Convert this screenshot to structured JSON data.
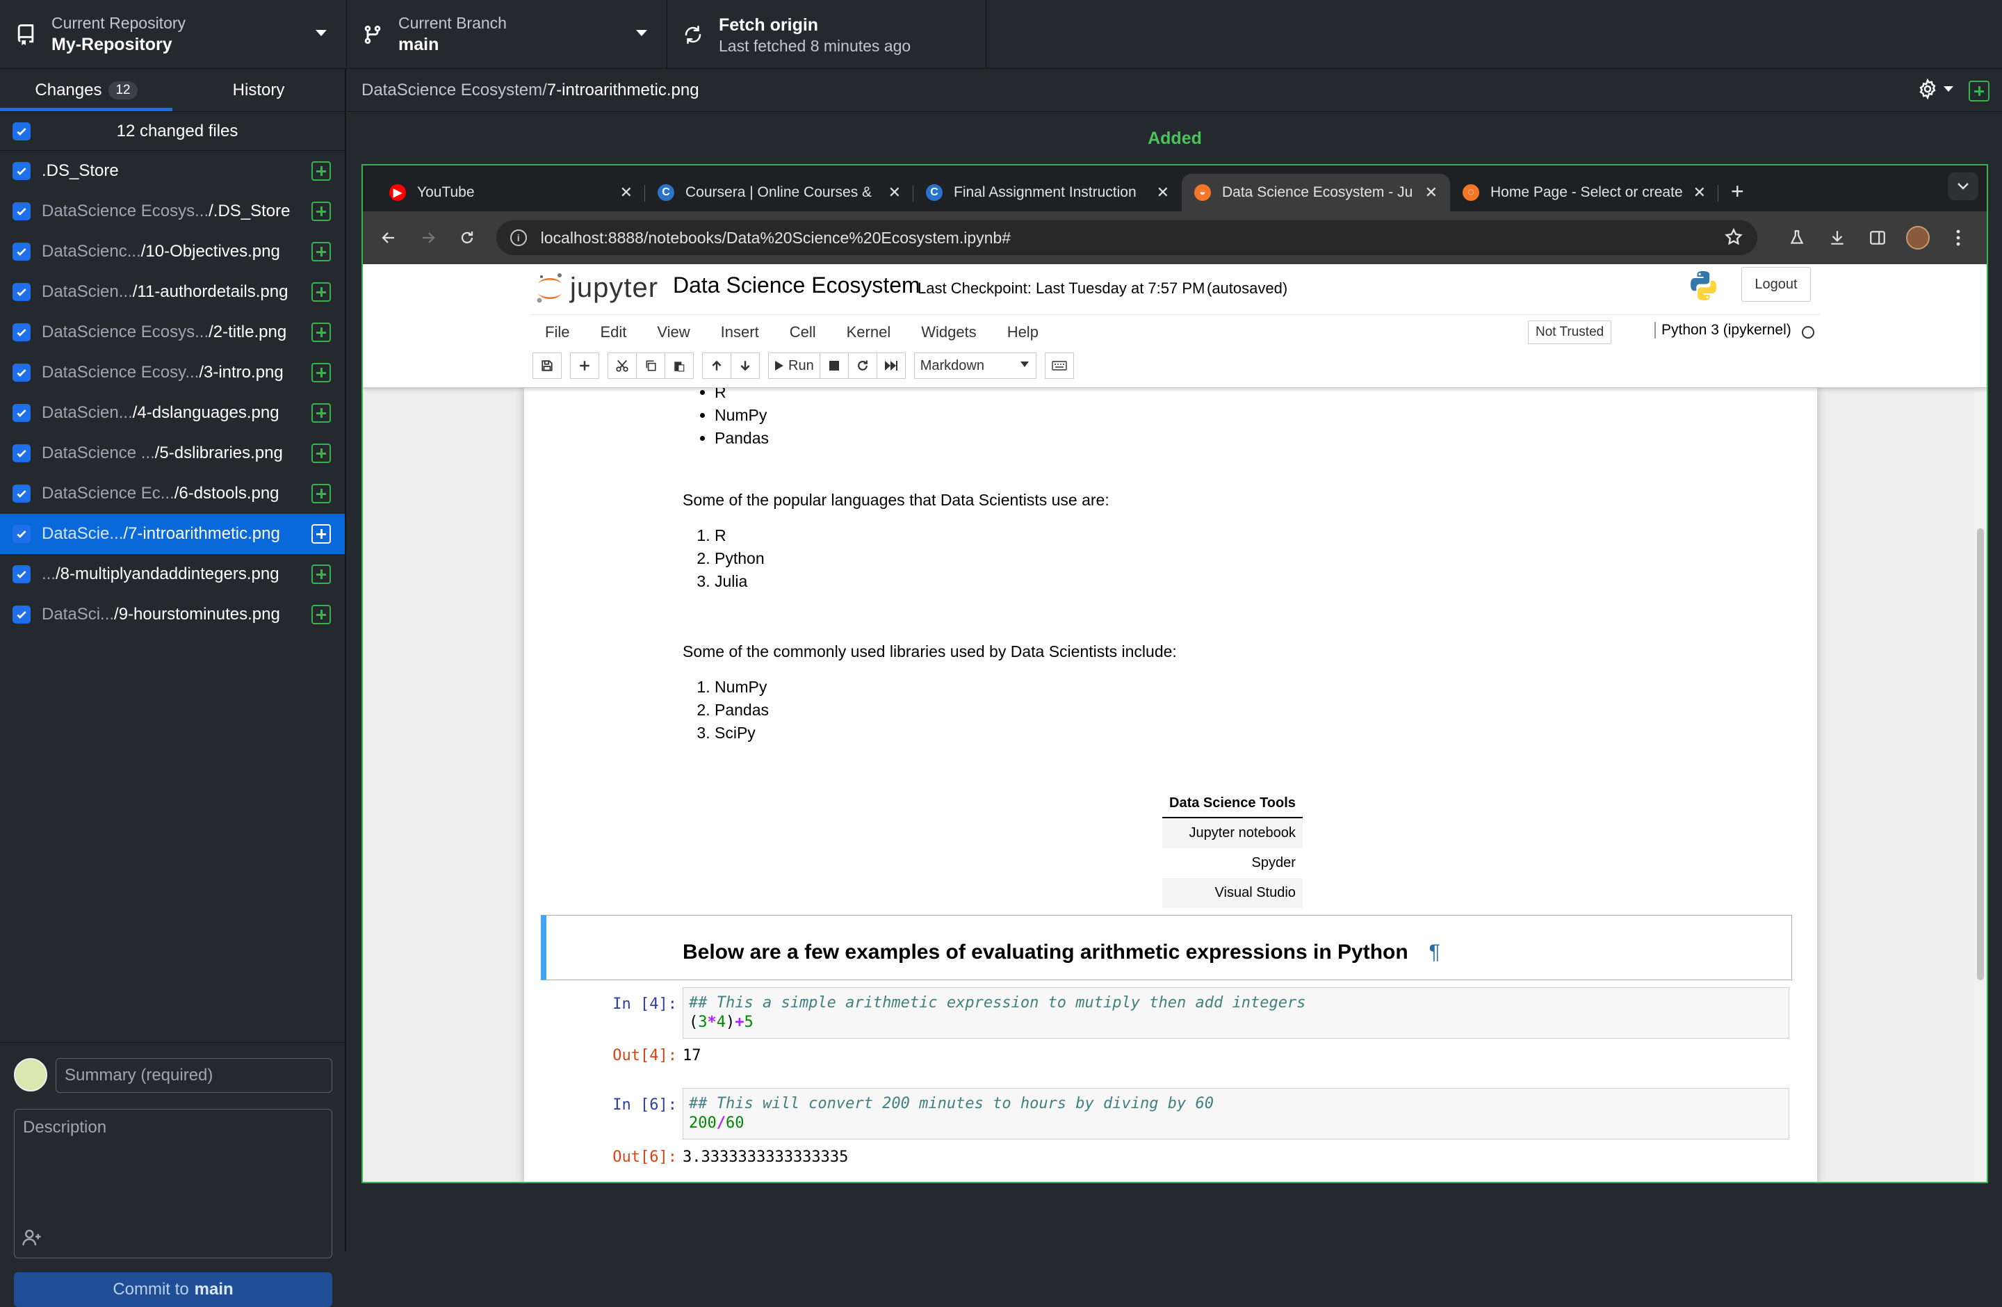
{
  "toolbar": {
    "repo_label": "Current Repository",
    "repo_value": "My-Repository",
    "branch_label": "Current Branch",
    "branch_value": "main",
    "fetch_label": "Fetch origin",
    "fetch_sub": "Last fetched 8 minutes ago"
  },
  "sidebar": {
    "tab_changes": "Changes",
    "changes_count": "12",
    "tab_history": "History",
    "changed_files_label": "12 changed files",
    "files": [
      {
        "dim": "",
        "name": ".DS_Store"
      },
      {
        "dim": "DataScience Ecosys...",
        "name": "/.DS_Store"
      },
      {
        "dim": "DataScienc...",
        "name": "/10-Objectives.png"
      },
      {
        "dim": "DataScien...",
        "name": "/11-authordetails.png"
      },
      {
        "dim": "DataScience Ecosys...",
        "name": "/2-title.png"
      },
      {
        "dim": "DataScience Ecosy...",
        "name": "/3-intro.png"
      },
      {
        "dim": "DataScien...",
        "name": "/4-dslanguages.png"
      },
      {
        "dim": "DataScience ...",
        "name": "/5-dslibraries.png"
      },
      {
        "dim": "DataScience Ec...",
        "name": "/6-dstools.png"
      },
      {
        "dim": "DataScie...",
        "name": "/7-introarithmetic.png"
      },
      {
        "dim": "...",
        "name": "/8-multiplyandaddintegers.png"
      },
      {
        "dim": "DataSci...",
        "name": "/9-hourstominutes.png"
      }
    ],
    "summary_placeholder": "Summary (required)",
    "description_placeholder": "Description",
    "commit_prefix": "Commit to",
    "commit_branch": "main"
  },
  "diff": {
    "path_dim": "DataScience Ecosystem/",
    "path_file": "7-introarithmetic.png",
    "status": "Added"
  },
  "browser": {
    "tabs": [
      {
        "title": "YouTube",
        "icon": "youtube-icon",
        "color": "#ff0000",
        "glyph": "▶"
      },
      {
        "title": "Coursera | Online Courses &",
        "icon": "coursera-icon",
        "color": "#2a73cc",
        "glyph": "C"
      },
      {
        "title": "Final Assignment Instruction",
        "icon": "coursera-icon",
        "color": "#2a73cc",
        "glyph": "C"
      },
      {
        "title": "Data Science Ecosystem - Ju",
        "icon": "jupyter-icon",
        "color": "#f37726",
        "glyph": "◒"
      },
      {
        "title": "Home Page - Select or create",
        "icon": "jupyter-icon",
        "color": "#f37726",
        "glyph": "◌"
      }
    ],
    "url": "localhost:8888/notebooks/Data%20Science%20Ecosystem.ipynb#"
  },
  "jupyter": {
    "logo_text": "jupyter",
    "notebook_name": "Data Science Ecosystem",
    "checkpoint": "Last Checkpoint: Last Tuesday at 7:57 PM",
    "autosaved": "(autosaved)",
    "logout": "Logout",
    "menu": [
      "File",
      "Edit",
      "View",
      "Insert",
      "Cell",
      "Kernel",
      "Widgets",
      "Help"
    ],
    "not_trusted": "Not Trusted",
    "kernel": "Python 3 (ipykernel)",
    "run_label": "Run",
    "cell_type": "Markdown"
  },
  "notebook": {
    "top_list": [
      "R",
      "NumPy",
      "Pandas"
    ],
    "languages_intro": "Some of the popular languages that Data Scientists use are:",
    "languages": [
      "R",
      "Python",
      "Julia"
    ],
    "libraries_intro": "Some of the commonly used libraries used by Data Scientists include:",
    "libraries": [
      "NumPy",
      "Pandas",
      "SciPy"
    ],
    "tools_header": "Data Science Tools",
    "tools": [
      "Jupyter notebook",
      "Spyder",
      "Visual Studio"
    ],
    "heading": "Below are a few examples of evaluating arithmetic expressions in Python",
    "pilcrow": "¶",
    "cell1_in": "In [4]:",
    "cell1_comment": "## This a simple arithmetic expression to mutiply then add integers",
    "cell1_out_prompt": "Out[4]:",
    "cell1_out": "17",
    "cell2_in": "In [6]:",
    "cell2_comment": "## This will convert 200 minutes to hours by diving by 60",
    "cell2_out_prompt": "Out[6]:",
    "cell2_out": "3.3333333333333335"
  },
  "colors": {
    "accent": "#1f6feb",
    "added": "#37b24d",
    "selected_row": "#0969da"
  }
}
